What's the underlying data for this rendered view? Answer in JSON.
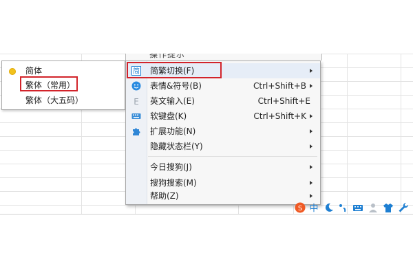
{
  "top_menu_cut_text": "操作提示",
  "submenu": {
    "items": [
      {
        "label": "简体",
        "selected": true
      },
      {
        "label": "繁体（常用）",
        "selected": false
      },
      {
        "label": "繁体（大五码）",
        "selected": false
      }
    ]
  },
  "menu": {
    "items": [
      {
        "label": "简繁切换(F)",
        "shortcut": "",
        "icon": "simplified-traditional-icon"
      },
      {
        "label": "表情&符号(B)",
        "shortcut": "Ctrl+Shift+B",
        "icon": "emoji-icon"
      },
      {
        "label": "英文输入(E)",
        "shortcut": "Ctrl+Shift+E",
        "icon": "english-input-icon"
      },
      {
        "label": "软键盘(K)",
        "shortcut": "Ctrl+Shift+K",
        "icon": "soft-keyboard-icon"
      },
      {
        "label": "扩展功能(N)",
        "shortcut": "",
        "icon": "puzzle-icon"
      },
      {
        "label": "隐藏状态栏(Y)",
        "shortcut": "",
        "icon": ""
      },
      {
        "label": "今日搜狗(J)",
        "shortcut": "",
        "icon": ""
      },
      {
        "label": "搜狗搜索(M)",
        "shortcut": "",
        "icon": ""
      },
      {
        "label": "帮助(Z)",
        "shortcut": "",
        "icon": ""
      }
    ]
  },
  "status_bar": {
    "icons": [
      "sogou-logo-icon",
      "chinese-mode-icon",
      "moon-icon",
      "punctuation-icon",
      "keyboard-icon",
      "user-icon",
      "skin-icon",
      "wrench-icon"
    ]
  },
  "colors": {
    "highlight_red": "#d2232a",
    "accent_blue": "#1e7fd2",
    "radio_yellow": "#f2c21d"
  }
}
